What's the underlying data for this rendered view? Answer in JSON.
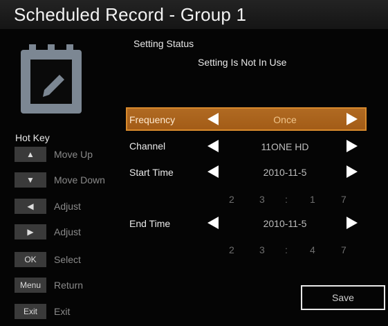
{
  "window": {
    "title": "Scheduled Record - Group 1"
  },
  "status": {
    "heading": "Setting Status",
    "value": "Setting Is Not In Use"
  },
  "hotkeys": {
    "title": "Hot Key",
    "items": [
      {
        "key": "▲",
        "label": "Move Up"
      },
      {
        "key": "▼",
        "label": "Move Down"
      },
      {
        "key": "◀",
        "label": "Adjust"
      },
      {
        "key": "▶",
        "label": "Adjust"
      },
      {
        "key": "OK",
        "label": "Select"
      },
      {
        "key": "Menu",
        "label": "Return"
      },
      {
        "key": "Exit",
        "label": "Exit"
      }
    ]
  },
  "fields": {
    "frequency": {
      "label": "Frequency",
      "value": "Once"
    },
    "channel": {
      "label": "Channel",
      "value": "11ONE HD"
    },
    "start_time": {
      "label": "Start Time",
      "date": "2010-11-5",
      "time": [
        "2",
        "3",
        ":",
        "1",
        "7"
      ]
    },
    "end_time": {
      "label": "End Time",
      "date": "2010-11-5",
      "time": [
        "2",
        "3",
        ":",
        "4",
        "7"
      ]
    }
  },
  "actions": {
    "save_label": "Save"
  },
  "colors": {
    "highlight": "#a35c17",
    "highlight_border": "#d88a2c",
    "background": "#050505",
    "key_bg": "#3a3a3a"
  },
  "icons": [
    "calendar-edit-icon",
    "arrow-left-icon",
    "arrow-right-icon",
    "arrow-up-icon",
    "arrow-down-icon"
  ]
}
